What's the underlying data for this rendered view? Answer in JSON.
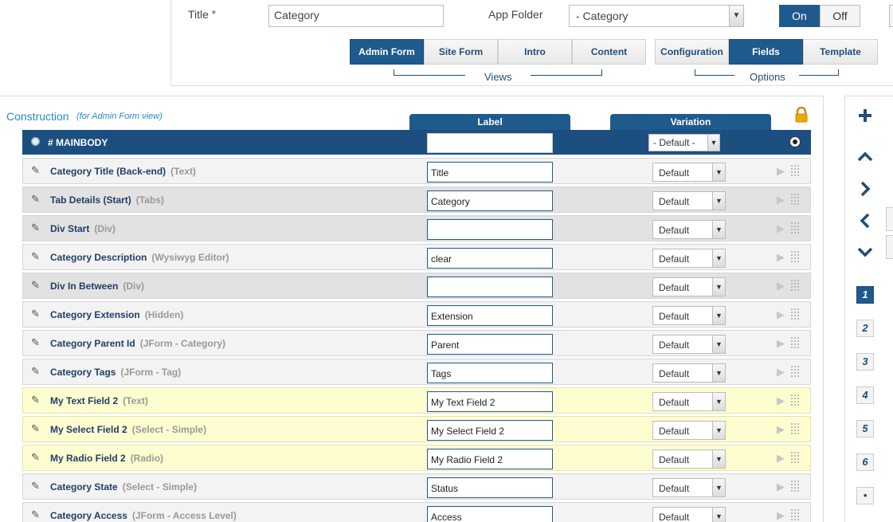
{
  "header": {
    "title_label": "Title",
    "required_mark": "*",
    "title_value": "Category",
    "app_folder_label": "App Folder",
    "app_folder_value": "- Category",
    "toggle_on": "On",
    "toggle_off": "Off"
  },
  "views": {
    "group_label": "Views",
    "tabs": [
      "Admin Form",
      "Site Form",
      "Intro",
      "Content"
    ],
    "active": "Admin Form"
  },
  "options": {
    "group_label": "Options",
    "tabs": [
      "Configuration",
      "Fields",
      "Template"
    ],
    "active": "Fields"
  },
  "construction": {
    "title": "Construction",
    "subtitle": "(for Admin Form view)",
    "label_col": "Label",
    "variation_col": "Variation",
    "mainbody": {
      "label": "# MAINBODY",
      "label_value": "",
      "variation_value": "- Default -"
    },
    "rows": [
      {
        "name": "Category Title (Back-end)",
        "type": "(Text)",
        "label": "Title",
        "variation": "Default"
      },
      {
        "name": "Tab Details (Start)",
        "type": "(Tabs)",
        "label": "Category",
        "variation": "Default"
      },
      {
        "name": "Div Start",
        "type": "(Div)",
        "label": "",
        "variation": "Default"
      },
      {
        "name": "Category Description",
        "type": "(Wysiwyg Editor)",
        "label": "clear",
        "variation": "Default"
      },
      {
        "name": "Div In Between",
        "type": "(Div)",
        "label": "",
        "variation": "Default"
      },
      {
        "name": "Category Extension",
        "type": "(Hidden)",
        "label": "Extension",
        "variation": "Default"
      },
      {
        "name": "Category Parent Id",
        "type": "(JForm - Category)",
        "label": "Parent",
        "variation": "Default"
      },
      {
        "name": "Category Tags",
        "type": "(JForm - Tag)",
        "label": "Tags",
        "variation": "Default"
      },
      {
        "name": "My Text Field 2",
        "type": "(Text)",
        "label": "My Text Field 2",
        "variation": "Default"
      },
      {
        "name": "My Select Field 2",
        "type": "(Select - Simple)",
        "label": "My Select Field 2",
        "variation": "Default"
      },
      {
        "name": "My Radio Field 2",
        "type": "(Radio)",
        "label": "My Radio Field 2",
        "variation": "Default"
      },
      {
        "name": "Category State",
        "type": "(Select - Simple)",
        "label": "Status",
        "variation": "Default"
      },
      {
        "name": "Category Access",
        "type": "(JForm - Access Level)",
        "label": "Access",
        "variation": "Default"
      }
    ]
  },
  "toolbar": {
    "icons": [
      "plus-icon",
      "chevron-up-icon",
      "chevron-right-icon",
      "chevron-left-icon",
      "chevron-down-icon"
    ],
    "pages": [
      "1",
      "2",
      "3",
      "4",
      "5",
      "6",
      "•"
    ],
    "active_page": "1"
  },
  "colors": {
    "primary": "#1f5a8d",
    "heading_blue": "#2a8ac9",
    "highlight_row": "#fdfdd0",
    "lock": "#e8a100"
  }
}
